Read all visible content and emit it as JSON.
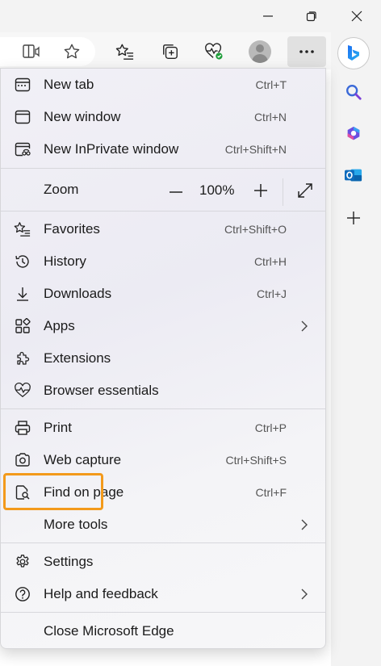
{
  "menu": {
    "items": [
      {
        "label": "New tab",
        "shortcut": "Ctrl+T",
        "icon": "new-tab-icon"
      },
      {
        "label": "New window",
        "shortcut": "Ctrl+N",
        "icon": "new-window-icon"
      },
      {
        "label": "New InPrivate window",
        "shortcut": "Ctrl+Shift+N",
        "icon": "inprivate-window-icon"
      },
      {
        "label": "Favorites",
        "shortcut": "Ctrl+Shift+O",
        "icon": "favorites-icon"
      },
      {
        "label": "History",
        "shortcut": "Ctrl+H",
        "icon": "history-icon"
      },
      {
        "label": "Downloads",
        "shortcut": "Ctrl+J",
        "icon": "download-icon"
      },
      {
        "label": "Apps",
        "shortcut": "",
        "icon": "apps-icon"
      },
      {
        "label": "Extensions",
        "shortcut": "",
        "icon": "extensions-icon"
      },
      {
        "label": "Browser essentials",
        "shortcut": "",
        "icon": "heartbeat-icon"
      },
      {
        "label": "Print",
        "shortcut": "Ctrl+P",
        "icon": "print-icon"
      },
      {
        "label": "Web capture",
        "shortcut": "Ctrl+Shift+S",
        "icon": "web-capture-icon"
      },
      {
        "label": "Find on page",
        "shortcut": "Ctrl+F",
        "icon": "find-icon"
      },
      {
        "label": "More tools",
        "shortcut": ""
      },
      {
        "label": "Settings",
        "shortcut": "",
        "icon": "gear-icon"
      },
      {
        "label": "Help and feedback",
        "shortcut": "",
        "icon": "help-icon"
      },
      {
        "label": "Close Microsoft Edge",
        "shortcut": ""
      }
    ],
    "zoom": {
      "label": "Zoom",
      "value": "100%"
    }
  },
  "colors": {
    "highlight": "#f39a1b",
    "accent": "#0078d4"
  }
}
